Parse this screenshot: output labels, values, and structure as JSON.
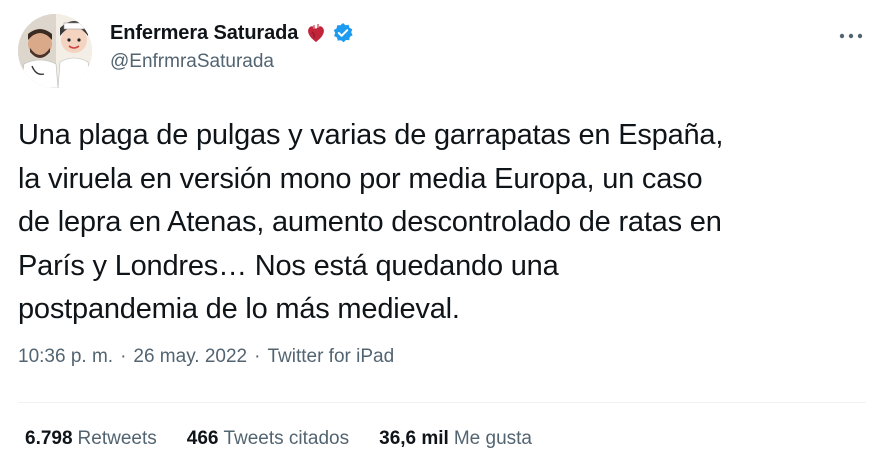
{
  "author": {
    "display_name": "Enfermera Saturada",
    "handle": "@EnfrmraSaturada",
    "emoji_icon": "anatomical-heart-icon",
    "verified_icon": "verified-badge-icon"
  },
  "tweet": {
    "text": "Una plaga de pulgas y varias de garrapatas en España,\nla viruela en versión mono por media Europa, un caso\nde lepra en Atenas, aumento descontrolado de ratas en\nParís y Londres… Nos está quedando una\npostpandemia de lo más medieval."
  },
  "meta": {
    "time": "10:36 p. m.",
    "separator1": "·",
    "date": "26 may. 2022",
    "separator2": "·",
    "source": "Twitter for iPad"
  },
  "stats": {
    "retweets_value": "6.798",
    "retweets_label": "Retweets",
    "quotes_value": "466",
    "quotes_label": "Tweets citados",
    "likes_value": "36,6 mil",
    "likes_label": "Me gusta"
  },
  "colors": {
    "text_primary": "#0f1419",
    "text_secondary": "#536471",
    "verified_blue": "#1d9bf0",
    "divider": "#eff3f4"
  }
}
